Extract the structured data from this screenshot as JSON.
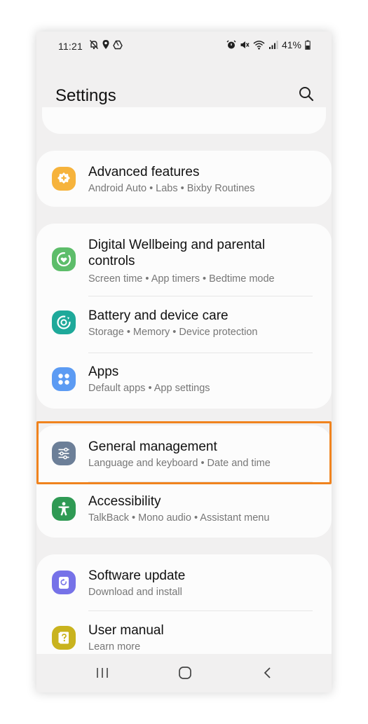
{
  "status_bar": {
    "time": "11:21",
    "battery": "41%"
  },
  "header": {
    "title": "Settings"
  },
  "cards": {
    "advanced": {
      "title": "Advanced features",
      "subtitle": "Android Auto  •  Labs  •  Bixby Routines",
      "icon": "puzzle-gear-icon",
      "color": "#f6b33c"
    },
    "wellbeing": {
      "title": "Digital Wellbeing and parental controls",
      "subtitle": "Screen time  •  App timers  •  Bedtime mode",
      "icon": "heart-ring-icon",
      "color": "#5dbd6a"
    },
    "battery": {
      "title": "Battery and device care",
      "subtitle": "Storage  •  Memory  •  Device protection",
      "icon": "device-care-icon",
      "color": "#1ea99a"
    },
    "apps": {
      "title": "Apps",
      "subtitle": "Default apps  •  App settings",
      "icon": "apps-grid-icon",
      "color": "#5c9bf3"
    },
    "general": {
      "title": "General management",
      "subtitle": "Language and keyboard  •  Date and time",
      "icon": "sliders-icon",
      "color": "#6c7f98"
    },
    "accessibility": {
      "title": "Accessibility",
      "subtitle": "TalkBack  •  Mono audio  •  Assistant menu",
      "icon": "accessibility-person-icon",
      "color": "#2f9a54"
    },
    "software": {
      "title": "Software update",
      "subtitle": "Download and install",
      "icon": "update-icon",
      "color": "#7672e8"
    },
    "manual": {
      "title": "User manual",
      "subtitle": "Learn more",
      "icon": "help-book-icon",
      "color": "#c9b31e"
    }
  },
  "highlight_color": "#f0831e"
}
